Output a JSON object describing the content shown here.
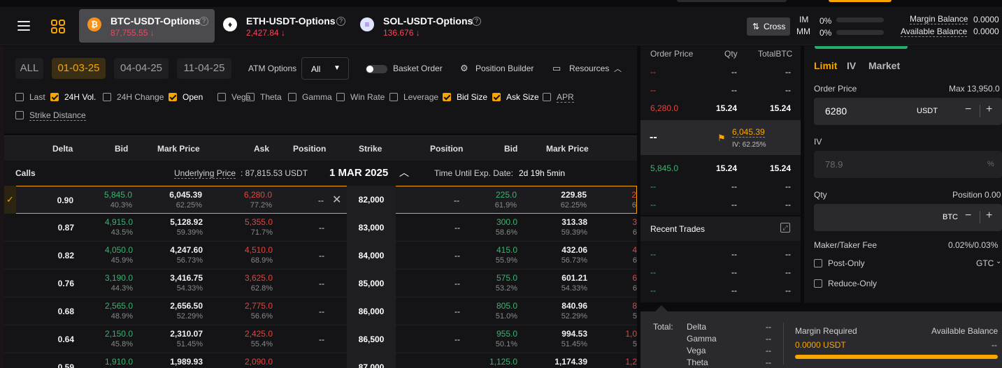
{
  "header": {
    "tabs": [
      {
        "name": "BTC-USDT-Options",
        "price": "87,755.55 ↓",
        "icon": "bitcoin-icon",
        "glyph": "₿"
      },
      {
        "name": "ETH-USDT-Options",
        "price": "2,427.84 ↓",
        "icon": "ethereum-icon",
        "glyph": "♦"
      },
      {
        "name": "SOL-USDT-Options",
        "price": "136.676 ↓",
        "icon": "solana-icon",
        "glyph": "≡"
      }
    ],
    "help_glyph": "?",
    "cross_label": "Cross",
    "im_label": "IM",
    "im_value": "0%",
    "mm_label": "MM",
    "mm_value": "0%",
    "margin_balance_label": "Margin Balance",
    "margin_balance_value": "0.0000",
    "available_balance_label": "Available Balance",
    "available_balance_value": "0.0000"
  },
  "filters": {
    "expiry_chips": [
      "ALL",
      "01-03-25",
      "04-04-25",
      "11-04-25"
    ],
    "selected_expiry": "01-03-25",
    "atm_label": "ATM Options",
    "atm_value": "All",
    "basket_label": "Basket Order",
    "position_builder_label": "Position Builder",
    "resources_label": "Resources",
    "columns": [
      {
        "label": "Last",
        "checked": false
      },
      {
        "label": "24H Vol.",
        "checked": true
      },
      {
        "label": "24H Change",
        "checked": false
      },
      {
        "label": "Open",
        "checked": true
      },
      {
        "label": "Vega",
        "checked": false
      },
      {
        "label": "Theta",
        "checked": false
      },
      {
        "label": "Gamma",
        "checked": false
      },
      {
        "label": "Win Rate",
        "checked": false
      },
      {
        "label": "Leverage",
        "checked": false
      },
      {
        "label": "Bid Size",
        "checked": true
      },
      {
        "label": "Ask Size",
        "checked": true
      },
      {
        "label": "APR",
        "checked": false
      }
    ],
    "strike_distance_label": "Strike Distance"
  },
  "table": {
    "headers": {
      "delta": "Delta",
      "bid": "Bid",
      "mark": "Mark Price",
      "ask": "Ask",
      "position": "Position",
      "strike": "Strike",
      "position2": "Position",
      "bid2": "Bid",
      "mark2": "Mark Price"
    },
    "calls_label": "Calls",
    "underlying_label": "Underlying Price",
    "underlying_value": ": 87,815.53 USDT",
    "date_label": "1 MAR 2025",
    "time_label": "Time Until Exp. Date:",
    "time_value": "2d 19h 5min",
    "rows": [
      {
        "delta": "0.90",
        "bid": "5,845.0",
        "bid_iv": "40.3%",
        "mark": "6,045.39",
        "mark_iv": "62.25%",
        "ask": "6,280.0",
        "ask_iv": "77.2%",
        "pos": "--",
        "strike": "82,000",
        "ppos": "--",
        "pbid": "225.0",
        "pbid_iv": "61.9%",
        "pmark": "229.85",
        "pmark_iv": "62.25%",
        "pask": "2",
        "pask_iv": "6"
      },
      {
        "delta": "0.87",
        "bid": "4,915.0",
        "bid_iv": "43.5%",
        "mark": "5,128.92",
        "mark_iv": "59.39%",
        "ask": "5,355.0",
        "ask_iv": "71.7%",
        "pos": "--",
        "strike": "83,000",
        "ppos": "--",
        "pbid": "300.0",
        "pbid_iv": "58.6%",
        "pmark": "313.38",
        "pmark_iv": "59.39%",
        "pask": "3",
        "pask_iv": "6"
      },
      {
        "delta": "0.82",
        "bid": "4,050.0",
        "bid_iv": "45.9%",
        "mark": "4,247.60",
        "mark_iv": "56.73%",
        "ask": "4,510.0",
        "ask_iv": "68.9%",
        "pos": "--",
        "strike": "84,000",
        "ppos": "--",
        "pbid": "415.0",
        "pbid_iv": "55.9%",
        "pmark": "432.06",
        "pmark_iv": "56.73%",
        "pask": "4",
        "pask_iv": "6"
      },
      {
        "delta": "0.76",
        "bid": "3,190.0",
        "bid_iv": "44.3%",
        "mark": "3,416.75",
        "mark_iv": "54.33%",
        "ask": "3,625.0",
        "ask_iv": "62.8%",
        "pos": "--",
        "strike": "85,000",
        "ppos": "--",
        "pbid": "575.0",
        "pbid_iv": "53.2%",
        "pmark": "601.21",
        "pmark_iv": "54.33%",
        "pask": "6",
        "pask_iv": "6"
      },
      {
        "delta": "0.68",
        "bid": "2,565.0",
        "bid_iv": "48.9%",
        "mark": "2,656.50",
        "mark_iv": "52.29%",
        "ask": "2,775.0",
        "ask_iv": "56.6%",
        "pos": "--",
        "strike": "86,000",
        "ppos": "--",
        "pbid": "805.0",
        "pbid_iv": "51.0%",
        "pmark": "840.96",
        "pmark_iv": "52.29%",
        "pask": "8",
        "pask_iv": "5"
      },
      {
        "delta": "0.64",
        "bid": "2,150.0",
        "bid_iv": "45.8%",
        "mark": "2,310.07",
        "mark_iv": "51.45%",
        "ask": "2,425.0",
        "ask_iv": "55.4%",
        "pos": "--",
        "strike": "86,500",
        "ppos": "--",
        "pbid": "955.0",
        "pbid_iv": "50.1%",
        "pmark": "994.53",
        "pmark_iv": "51.45%",
        "pask": "1,0",
        "pask_iv": "5"
      },
      {
        "delta": "0.59",
        "bid": "1,910.0",
        "bid_iv": "",
        "mark": "1,989.93",
        "mark_iv": "",
        "ask": "2,090.0",
        "ask_iv": "",
        "pos": "",
        "strike": "87,000",
        "ppos": "",
        "pbid": "1,125.0",
        "pbid_iv": "",
        "pmark": "1,174.39",
        "pmark_iv": "",
        "pask": "1,2",
        "pask_iv": ""
      }
    ]
  },
  "orderbook": {
    "headers": {
      "price": "Order Price",
      "qty": "Qty",
      "total": "TotalBTC"
    },
    "asks": [
      {
        "price": "--",
        "qty": "--",
        "total": "--"
      },
      {
        "price": "--",
        "qty": "--",
        "total": "--"
      },
      {
        "price": "6,280.0",
        "qty": "15.24",
        "total": "15.24"
      }
    ],
    "mid_label": "--",
    "mark_value": "6,045.39",
    "iv_value": "IV: 62.25%",
    "bids": [
      {
        "price": "5,845.0",
        "qty": "15.24",
        "total": "15.24"
      },
      {
        "price": "--",
        "qty": "--",
        "total": "--"
      },
      {
        "price": "--",
        "qty": "--",
        "total": "--"
      }
    ],
    "recent_trades_label": "Recent Trades",
    "trades": [
      {
        "price": "--",
        "qty": "--",
        "total": "--"
      },
      {
        "price": "--",
        "qty": "--",
        "total": "--"
      },
      {
        "price": "--",
        "qty": "--",
        "total": "--"
      }
    ]
  },
  "order_form": {
    "tabs": [
      "Limit",
      "IV",
      "Market"
    ],
    "order_price_label": "Order Price",
    "max_label": "Max 13,950.0",
    "price_value": "6280",
    "price_unit": "USDT",
    "iv_label": "IV",
    "iv_placeholder": "78.9",
    "iv_unit": "%",
    "qty_label": "Qty",
    "position_label": "Position 0.00",
    "qty_unit": "BTC",
    "fee_label": "Maker/Taker Fee",
    "fee_value": "0.02%/0.03%",
    "post_only_label": "Post-Only",
    "gtc_label": "GTC",
    "reduce_only_label": "Reduce-Only"
  },
  "summary": {
    "total_label": "Total:",
    "greeks": [
      {
        "label": "Delta",
        "value": "--"
      },
      {
        "label": "Gamma",
        "value": "--"
      },
      {
        "label": "Vega",
        "value": "--"
      },
      {
        "label": "Theta",
        "value": "--"
      }
    ],
    "margin_required_label": "Margin Required",
    "margin_required_value": "0.0000 USDT",
    "available_balance_label": "Available Balance",
    "available_balance_value": "--"
  },
  "colors": {
    "accent": "#f7a600",
    "buy": "#3cb371",
    "sell": "#e0463e"
  }
}
